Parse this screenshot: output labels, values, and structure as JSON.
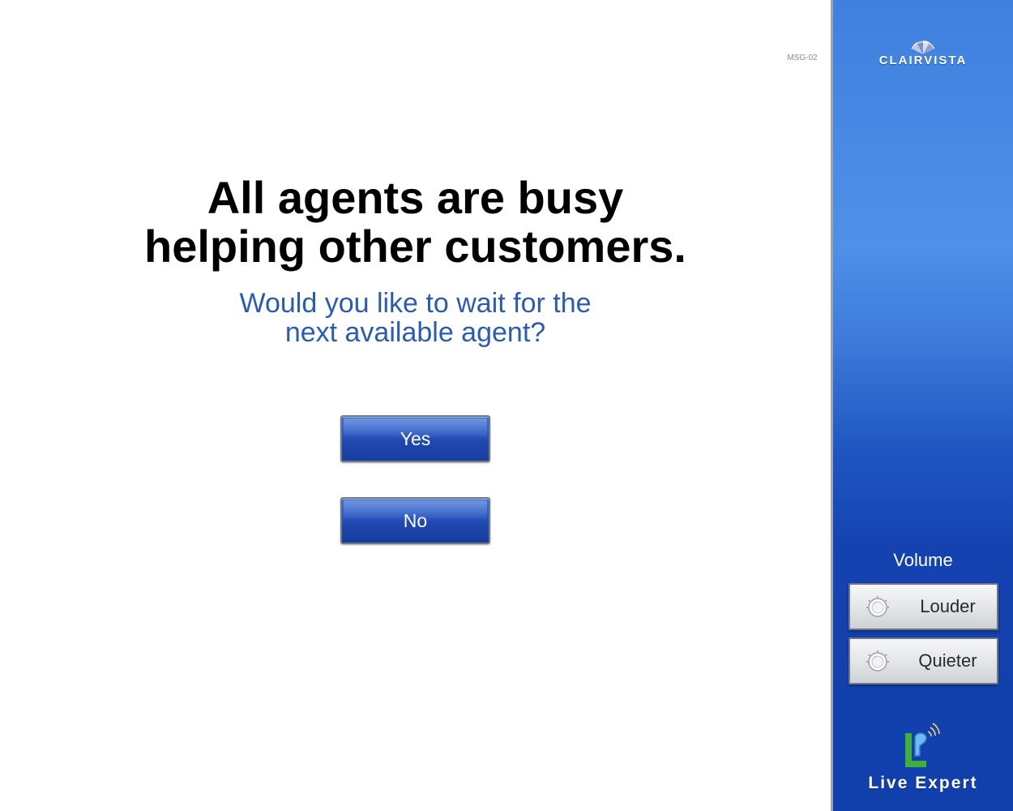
{
  "screen": {
    "code": "MSG-02"
  },
  "message": {
    "headline_lines": [
      "All agents are busy",
      "helping other customers."
    ],
    "question_lines": [
      "Would you like to wait for the",
      "next available agent?"
    ]
  },
  "actions": {
    "yes_label": "Yes",
    "no_label": "No"
  },
  "sidebar": {
    "brand_name": "ClairVista",
    "volume": {
      "label": "Volume",
      "louder_label": "Louder",
      "quieter_label": "Quieter"
    },
    "product_name": "Live Expert"
  },
  "colors": {
    "sidebar_blue": "#2057c2",
    "button_blue": "#1f47ad",
    "question_text": "#2a5bb5",
    "logo_green": "#3fb13a"
  },
  "icons": {
    "volume_button": "knob-icon",
    "brand": "clairvista-logo",
    "product": "live-expert-logo"
  }
}
